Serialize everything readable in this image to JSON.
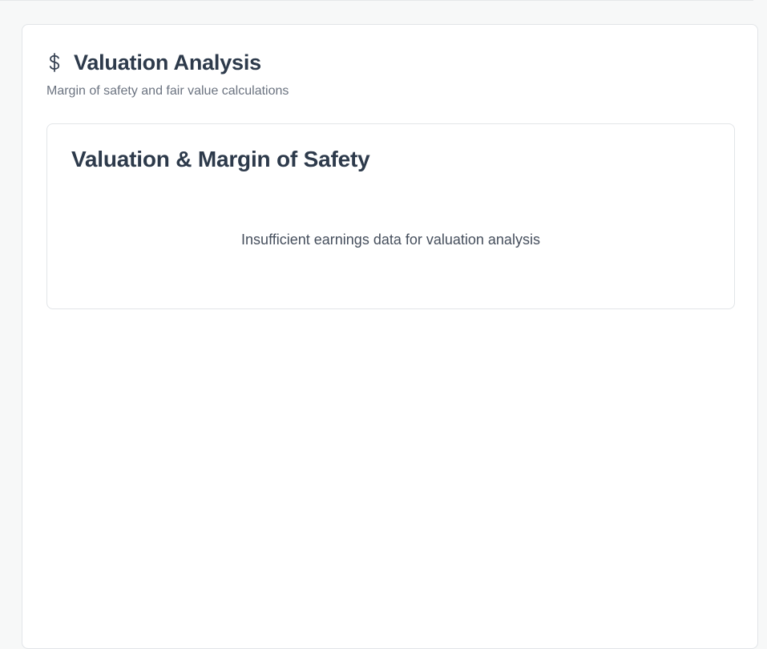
{
  "section": {
    "icon": "dollar-icon",
    "title": "Valuation Analysis",
    "subtitle": "Margin of safety and fair value calculations"
  },
  "valuation_card": {
    "title": "Valuation & Margin of Safety",
    "empty_message": "Insufficient earnings data for valuation analysis"
  },
  "colors": {
    "page_background": "#f7f8f8",
    "card_background": "#ffffff",
    "card_border": "#e2e5e8",
    "title_text": "#2d3a4b",
    "subtitle_text": "#6b7380",
    "body_text": "#454e5c"
  }
}
